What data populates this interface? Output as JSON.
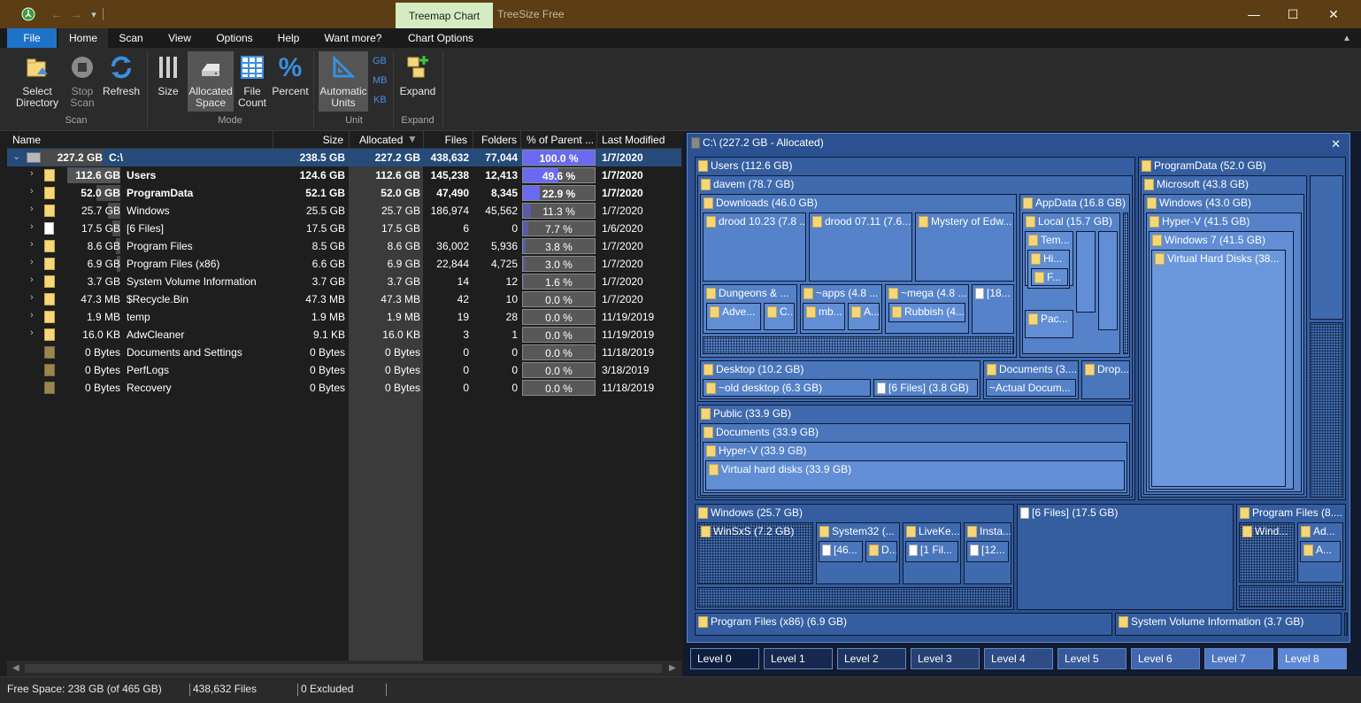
{
  "titlebar": {
    "context_tab": "Treemap Chart",
    "app_title": "TreeSize Free"
  },
  "ribbon_tabs": [
    "File",
    "Home",
    "Scan",
    "View",
    "Options",
    "Help",
    "Want more?",
    "Chart Options"
  ],
  "ribbon": {
    "select_directory": "Select\nDirectory",
    "stop_scan": "Stop\nScan",
    "refresh": "Refresh",
    "size": "Size",
    "allocated_space": "Allocated\nSpace",
    "file_count": "File\nCount",
    "percent": "Percent",
    "automatic_units": "Automatic\nUnits",
    "unit_gb": "GB",
    "unit_mb": "MB",
    "unit_kb": "KB",
    "expand": "Expand",
    "group_scan": "Scan",
    "group_mode": "Mode",
    "group_unit": "Unit",
    "group_expand": "Expand"
  },
  "columns": [
    "Name",
    "Size",
    "Allocated",
    "Files",
    "Folders",
    "% of Parent ...",
    "Last Modified"
  ],
  "rows": [
    {
      "label_size": "227.2 GB",
      "name": "C:\\",
      "size": "238.5 GB",
      "allocated": "227.2 GB",
      "files": "438,632",
      "folders": "77,044",
      "pct": "100.0 %",
      "pct_value": 100.0,
      "modified": "1/7/2020"
    },
    {
      "label_size": "112.6 GB",
      "name": "Users",
      "size": "124.6 GB",
      "allocated": "112.6 GB",
      "files": "145,238",
      "folders": "12,413",
      "pct": "49.6 %",
      "pct_value": 49.6,
      "modified": "1/7/2020"
    },
    {
      "label_size": "52.0 GB",
      "name": "ProgramData",
      "size": "52.1 GB",
      "allocated": "52.0 GB",
      "files": "47,490",
      "folders": "8,345",
      "pct": "22.9 %",
      "pct_value": 22.9,
      "modified": "1/7/2020"
    },
    {
      "label_size": "25.7 GB",
      "name": "Windows",
      "size": "25.5 GB",
      "allocated": "25.7 GB",
      "files": "186,974",
      "folders": "45,562",
      "pct": "11.3 %",
      "pct_value": 11.3,
      "modified": "1/7/2020"
    },
    {
      "label_size": "17.5 GB",
      "name": "[6 Files]",
      "size": "17.5 GB",
      "allocated": "17.5 GB",
      "files": "6",
      "folders": "0",
      "pct": "7.7 %",
      "pct_value": 7.7,
      "modified": "1/6/2020"
    },
    {
      "label_size": "8.6 GB",
      "name": "Program Files",
      "size": "8.5 GB",
      "allocated": "8.6 GB",
      "files": "36,002",
      "folders": "5,936",
      "pct": "3.8 %",
      "pct_value": 3.8,
      "modified": "1/7/2020"
    },
    {
      "label_size": "6.9 GB",
      "name": "Program Files (x86)",
      "size": "6.6 GB",
      "allocated": "6.9 GB",
      "files": "22,844",
      "folders": "4,725",
      "pct": "3.0 %",
      "pct_value": 3.0,
      "modified": "1/7/2020"
    },
    {
      "label_size": "3.7 GB",
      "name": "System Volume Information",
      "size": "3.7 GB",
      "allocated": "3.7 GB",
      "files": "14",
      "folders": "12",
      "pct": "1.6 %",
      "pct_value": 1.6,
      "modified": "1/7/2020"
    },
    {
      "label_size": "47.3 MB",
      "name": "$Recycle.Bin",
      "size": "47.3 MB",
      "allocated": "47.3 MB",
      "files": "42",
      "folders": "10",
      "pct": "0.0 %",
      "pct_value": 0.0,
      "modified": "1/7/2020"
    },
    {
      "label_size": "1.9 MB",
      "name": "temp",
      "size": "1.9 MB",
      "allocated": "1.9 MB",
      "files": "19",
      "folders": "28",
      "pct": "0.0 %",
      "pct_value": 0.0,
      "modified": "11/19/2019"
    },
    {
      "label_size": "16.0 KB",
      "name": "AdwCleaner",
      "size": "9.1 KB",
      "allocated": "16.0 KB",
      "files": "3",
      "folders": "1",
      "pct": "0.0 %",
      "pct_value": 0.0,
      "modified": "11/19/2019"
    },
    {
      "label_size": "0 Bytes",
      "name": "Documents and Settings",
      "size": "0 Bytes",
      "allocated": "0 Bytes",
      "files": "0",
      "folders": "0",
      "pct": "0.0 %",
      "pct_value": 0.0,
      "modified": "11/18/2019"
    },
    {
      "label_size": "0 Bytes",
      "name": "PerfLogs",
      "size": "0 Bytes",
      "allocated": "0 Bytes",
      "files": "0",
      "folders": "0",
      "pct": "0.0 %",
      "pct_value": 0.0,
      "modified": "3/18/2019"
    },
    {
      "label_size": "0 Bytes",
      "name": "Recovery",
      "size": "0 Bytes",
      "allocated": "0 Bytes",
      "files": "0",
      "folders": "0",
      "pct": "0.0 %",
      "pct_value": 0.0,
      "modified": "11/18/2019"
    }
  ],
  "treemap": {
    "root": "C:\\ (227.2 GB - Allocated)",
    "users": "Users (112.6 GB)",
    "davem": "davem (78.7 GB)",
    "downloads": "Downloads (46.0 GB)",
    "drood1023": "drood 10.23 (7.8 ...",
    "drood0711": "drood 07.11 (7.6...",
    "mystery": "Mystery of Edw...",
    "dungeons": "Dungeons & ...",
    "apps": "~apps (4.8 ...",
    "mega": "~mega (4.8 ...",
    "files18": "[18...",
    "adve": "Adve...",
    "c_small": "C...",
    "mb": "mb...",
    "a_small": "A...",
    "rubbish": "Rubbish (4...",
    "appdata": "AppData (16.8 GB)",
    "local": "Local (15.7 GB)",
    "tem": "Tem...",
    "hi": "Hi...",
    "f": "F...",
    "pac": "Pac...",
    "desktop": "Desktop (10.2 GB)",
    "old_desktop": "~old desktop (6.3 GB)",
    "desktop_files": "[6 Files] (3.8 GB)",
    "documents_davem": "Documents (3....",
    "actual_docum": "~Actual Docum...",
    "dropbox": "Drop...",
    "public": "Public (33.9 GB)",
    "public_documents": "Documents (33.9 GB)",
    "hyperv_public": "Hyper-V (33.9 GB)",
    "vhd_public": "Virtual hard disks (33.9 GB)",
    "programdata": "ProgramData (52.0 GB)",
    "microsoft": "Microsoft (43.8 GB)",
    "pd_windows": "Windows (43.0 GB)",
    "pd_hyperv": "Hyper-V (41.5 GB)",
    "windows7": "Windows 7 (41.5 GB)",
    "vhd_pd": "Virtual Hard Disks (38...",
    "windows": "Windows (25.7 GB)",
    "winsxs": "WinSxS (7.2 GB)",
    "system32": "System32 (...",
    "liveke": "LiveKe...",
    "insta": "Insta...",
    "f46": "[46...",
    "d_small": "D...",
    "one_fil": "[1 Fil...",
    "f12": "[12...",
    "root_files": "[6 Files] (17.5 GB)",
    "program_files": "Program Files (8....",
    "wind": "Wind...",
    "ad": "Ad...",
    "a_pf": "A...",
    "program_files_x86": "Program Files (x86) (6.9 GB)",
    "svi": "System Volume Information (3.7 GB)"
  },
  "levels": [
    "Level 0",
    "Level 1",
    "Level 2",
    "Level 3",
    "Level 4",
    "Level 5",
    "Level 6",
    "Level 7",
    "Level 8"
  ],
  "status": {
    "free_space": "Free Space: 238 GB  (of 465 GB)",
    "files": "438,632 Files",
    "excluded": "0 Excluded"
  }
}
